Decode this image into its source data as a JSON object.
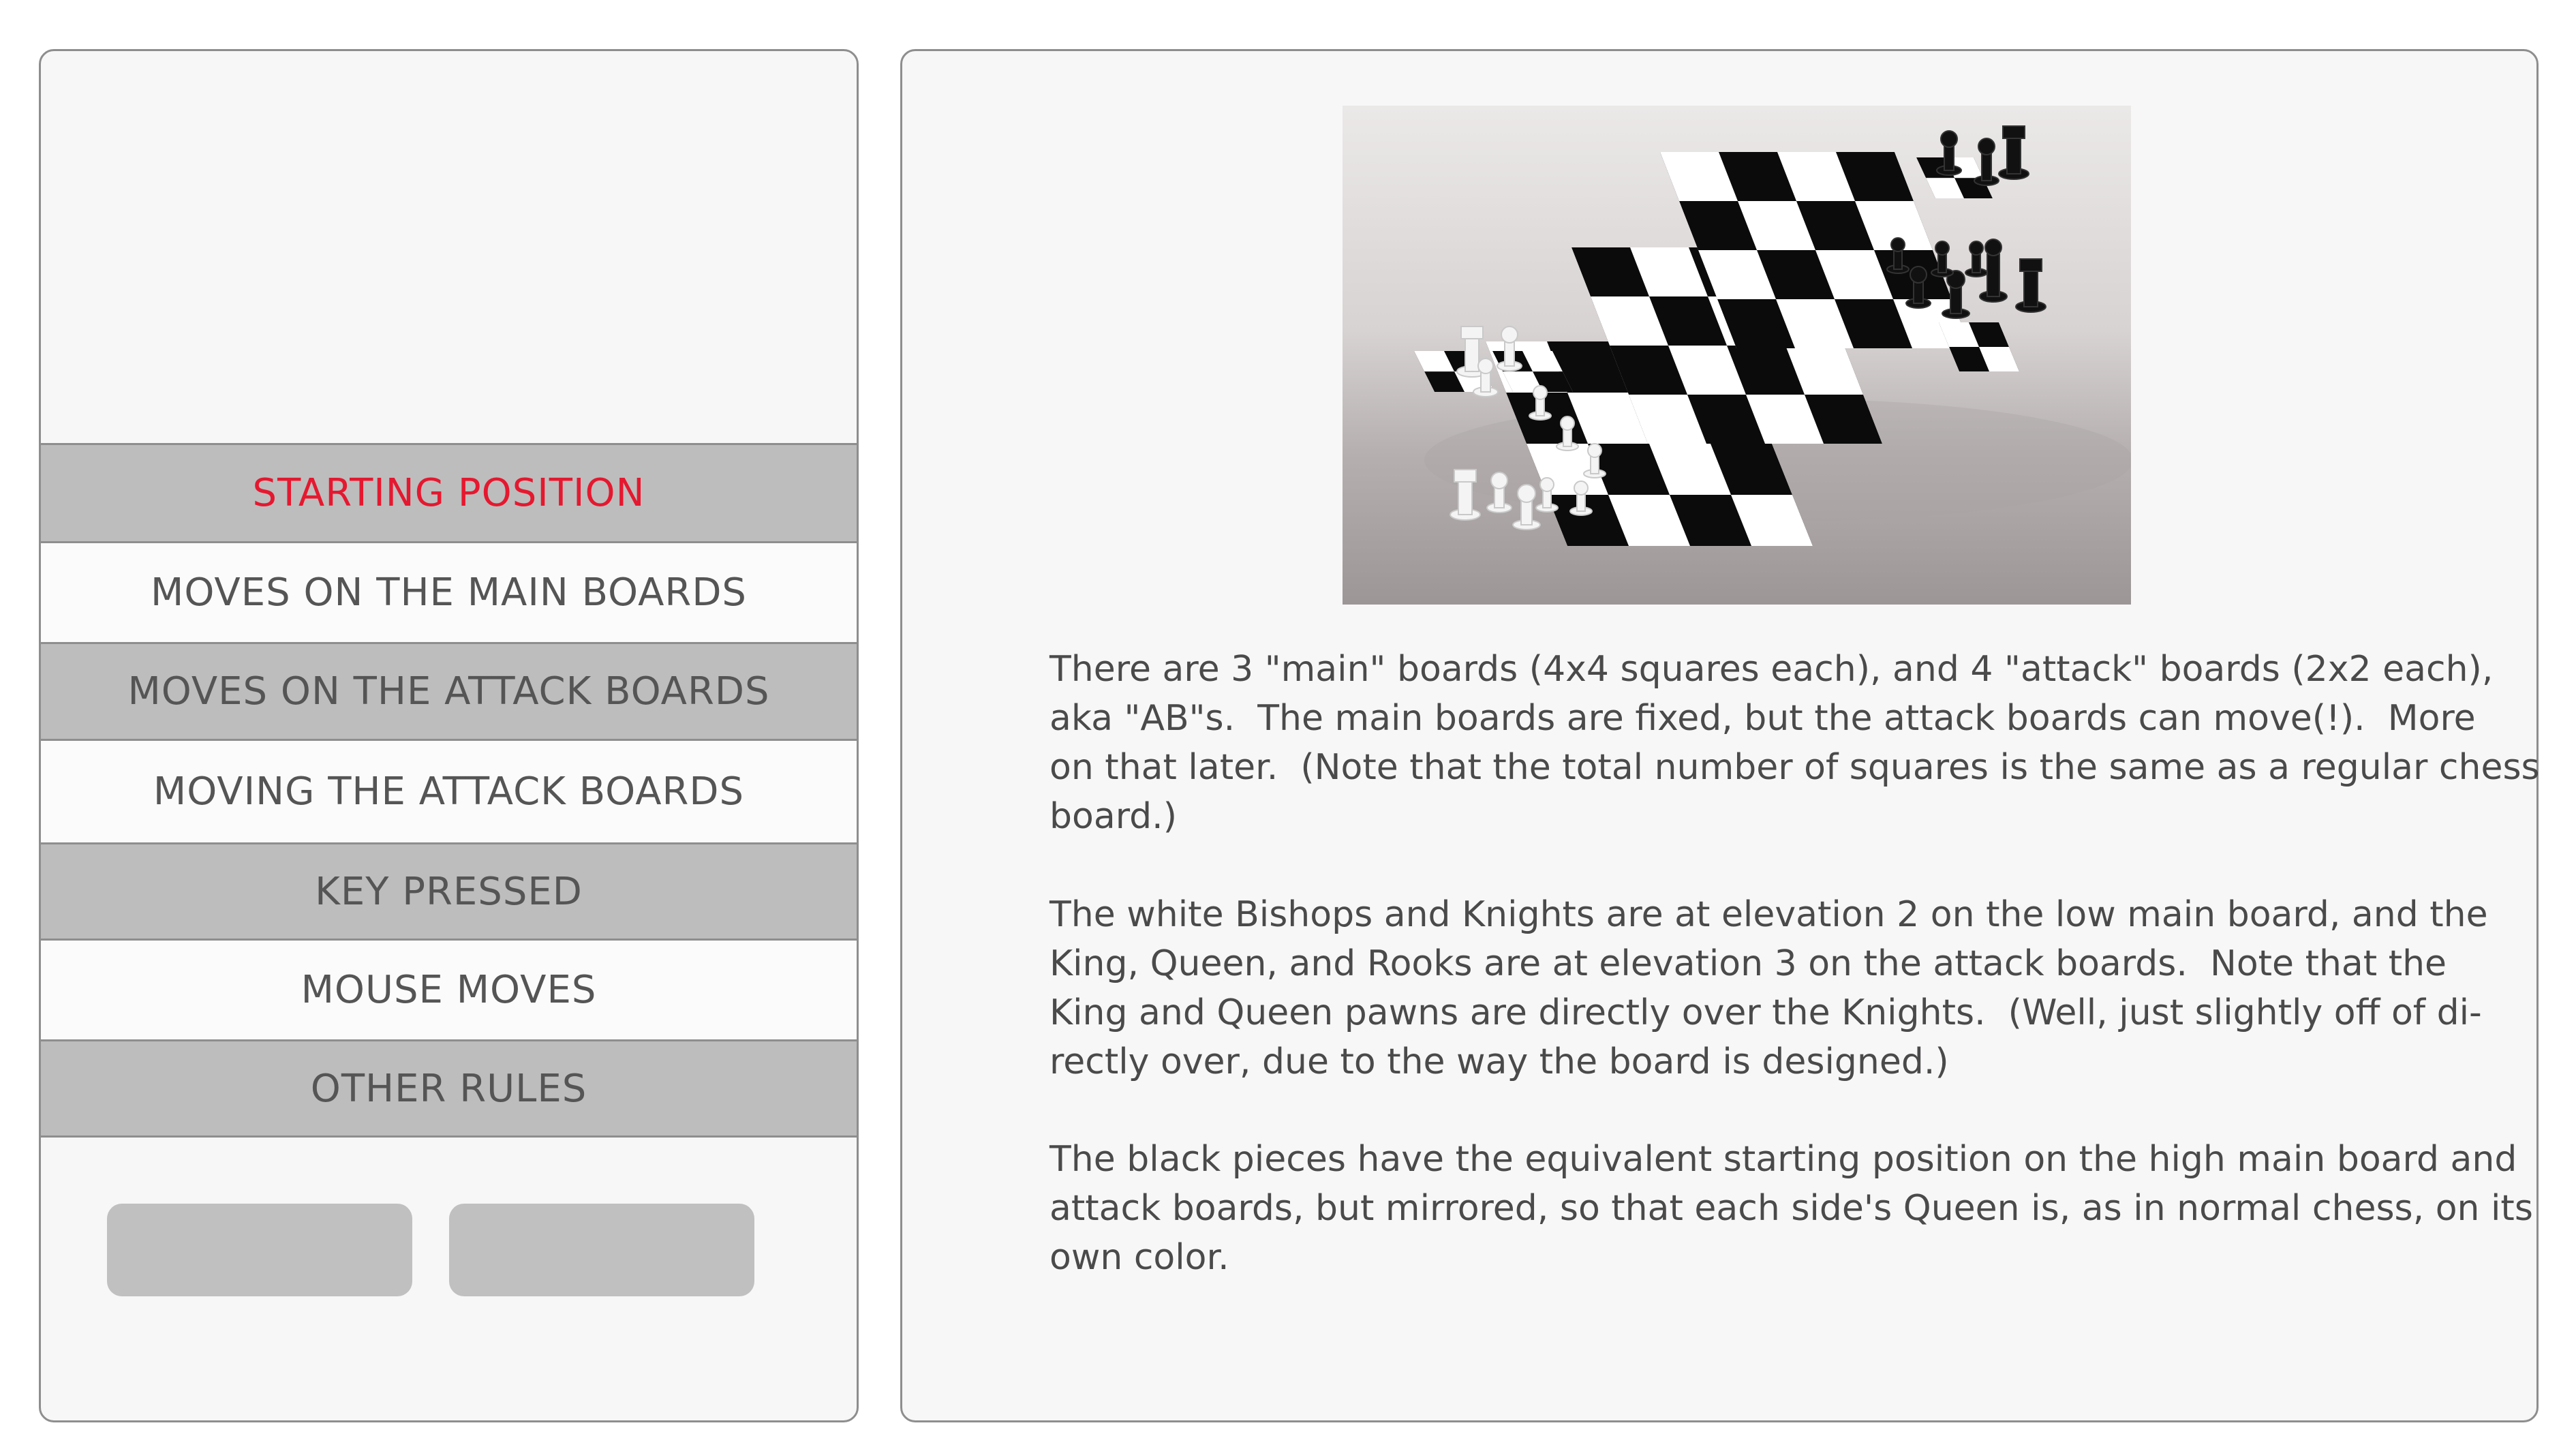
{
  "menu": {
    "items": [
      {
        "label": "STARTING POSITION",
        "active": true
      },
      {
        "label": "MOVES ON THE MAIN BOARDS",
        "active": false
      },
      {
        "label": "MOVES ON THE ATTACK BOARDS",
        "active": false
      },
      {
        "label": "MOVING THE ATTACK BOARDS",
        "active": false
      },
      {
        "label": "KEY PRESSED",
        "active": false
      },
      {
        "label": "MOUSE MOVES",
        "active": false
      },
      {
        "label": "OTHER RULES",
        "active": false
      }
    ],
    "active_color": "#e5182f"
  },
  "content": {
    "paragraphs": [
      {
        "lines": [
          "There are 3 \"main\" boards (4x4 squares each), and 4 \"attack\" boards (2x2 each),",
          "aka \"AB\"s.  The main boards are fixed, but the attack boards can move(!).  More",
          "on that later.  (Note that the total number of squares is the same as a regular chess",
          "board.)"
        ]
      },
      {
        "lines": [
          "The white Bishops and Knights are at elevation 2 on the low main board, and the",
          "King, Queen, and Rooks are at elevation 3 on the attack boards.  Note that the",
          "King and Queen pawns are directly over the Knights.  (Well, just slightly off of di-",
          "rectly over, due to the way the board is designed.)"
        ]
      },
      {
        "lines": [
          "The black pieces have the equivalent starting position on the high main board and",
          "attack boards, but mirrored, so that each side's Queen is, as in normal chess, on its",
          "own color."
        ]
      }
    ]
  }
}
